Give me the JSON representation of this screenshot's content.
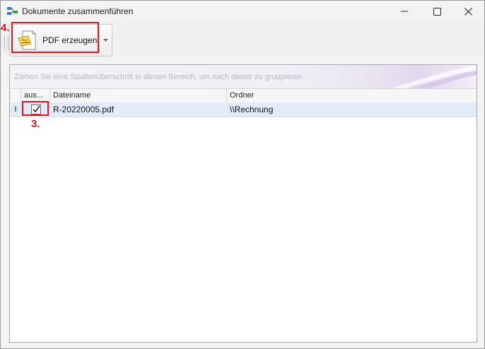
{
  "window": {
    "title": "Dokumente zusammenführen"
  },
  "toolbar": {
    "pdf_button_label": "PDF erzeugen"
  },
  "grid": {
    "group_panel_text": "Ziehen Sie eine Spaltenüberschrift in diesen Bereich, um nach dieser zu gruppieren",
    "columns": [
      "aus...",
      "Dateiname",
      "Ordner"
    ],
    "rows": [
      {
        "row_indicator": "I",
        "selected": true,
        "dateiname": "R-20220005.pdf",
        "ordner": "\\\\Rechnung"
      }
    ]
  },
  "annotations": {
    "step_3": "3.",
    "step_4": "4."
  },
  "colors": {
    "highlight": "#e0141e",
    "row_selected": "#e1ebfa"
  }
}
